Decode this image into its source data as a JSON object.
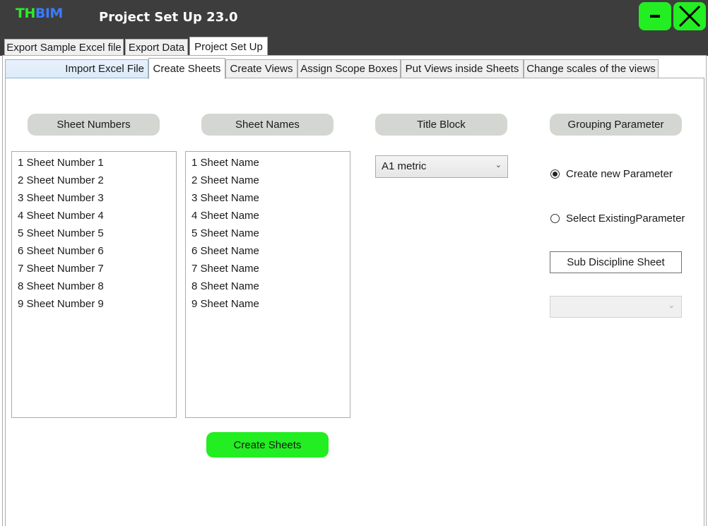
{
  "app": {
    "logo_th": "TH",
    "logo_bim": "BIM",
    "title": "Project Set Up 23.0"
  },
  "window_controls": {
    "minimize_icon": "minimize-icon",
    "close_icon": "close-icon"
  },
  "main_tabs": [
    {
      "label": "Export Sample Excel file"
    },
    {
      "label": "Export Data"
    },
    {
      "label": "Project Set Up",
      "active": true
    }
  ],
  "sub_tabs": [
    {
      "label": "Import Excel File"
    },
    {
      "label": "Create Sheets",
      "active": true
    },
    {
      "label": "Create Views"
    },
    {
      "label": "Assign Scope Boxes"
    },
    {
      "label": "Put Views inside Sheets"
    },
    {
      "label": "Change scales of the views"
    }
  ],
  "headers": {
    "sheet_numbers": "Sheet Numbers",
    "sheet_names": "Sheet Names",
    "title_block": "Title Block",
    "grouping_parameter": "Grouping Parameter"
  },
  "sheet_numbers": [
    "1 Sheet Number 1",
    "2 Sheet Number 2",
    "3 Sheet Number 3",
    "4 Sheet Number 4",
    "5 Sheet Number 5",
    "6 Sheet Number 6",
    "7 Sheet Number 7",
    "8 Sheet Number 8",
    "9 Sheet Number 9"
  ],
  "sheet_names": [
    "1 Sheet Name",
    "2 Sheet Name",
    "3 Sheet Name",
    "4 Sheet Name",
    "5 Sheet Name",
    "6 Sheet Name",
    "7 Sheet Name",
    "8 Sheet Name",
    "9 Sheet Name"
  ],
  "title_block": {
    "selected": "A1 metric"
  },
  "grouping": {
    "option_new": "Create new Parameter",
    "option_existing": "Select ExistingParameter",
    "selected": "new",
    "sub_discipline": "Sub Discipline Sheet",
    "existing_select_value": ""
  },
  "create_button": "Create Sheets",
  "colors": {
    "accent_green": "#22ee22",
    "titlebar": "#3d3d3d",
    "pill": "#d4d6d1"
  }
}
